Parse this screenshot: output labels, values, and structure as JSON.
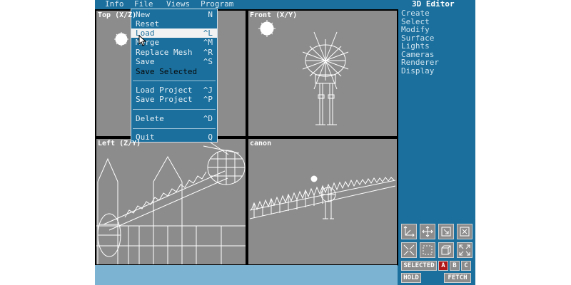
{
  "app": {
    "title": "3D Editor",
    "menubar": [
      "Info",
      "File",
      "Views",
      "Program"
    ]
  },
  "file_menu": {
    "items": [
      {
        "label": "New",
        "shortcut": "N"
      },
      {
        "label": "Reset",
        "shortcut": ""
      },
      {
        "label": "Load",
        "shortcut": "^L"
      },
      {
        "label": "Merge",
        "shortcut": "^M"
      },
      {
        "label": "Replace Mesh",
        "shortcut": "^R"
      },
      {
        "label": "Save",
        "shortcut": "^S"
      },
      {
        "label": "Save Selected",
        "shortcut": ""
      },
      {
        "label": "Load Project",
        "shortcut": "^J"
      },
      {
        "label": "Save Project",
        "shortcut": "^P"
      },
      {
        "label": "Delete",
        "shortcut": "^D"
      },
      {
        "label": "Quit",
        "shortcut": "Q"
      }
    ],
    "highlighted": "Load"
  },
  "viewports": {
    "top": "Top (X/Z)",
    "front": "Front (X/Y)",
    "left": "Left (Z/Y)",
    "camera": "canon"
  },
  "commands": [
    "Create",
    "Select",
    "Modify",
    "Surface",
    "Lights",
    "Cameras",
    "Renderer",
    "Display"
  ],
  "toolbar": {
    "icons": [
      "axis-icon",
      "move-icon",
      "scale-box-icon",
      "rotate-box-icon",
      "shrink-icon",
      "region-icon",
      "cube-icon",
      "expand-icon"
    ],
    "selected_label": "SELECTED",
    "selection_sets": [
      "A",
      "B",
      "C"
    ],
    "active_set": "A",
    "hold_label": "HOLD",
    "fetch_label": "FETCH"
  },
  "colors": {
    "panel_blue": "#1a6f9d",
    "viewport_gray": "#8c8c8c",
    "status_blue": "#7db3d2",
    "active_red": "#b0181a"
  }
}
